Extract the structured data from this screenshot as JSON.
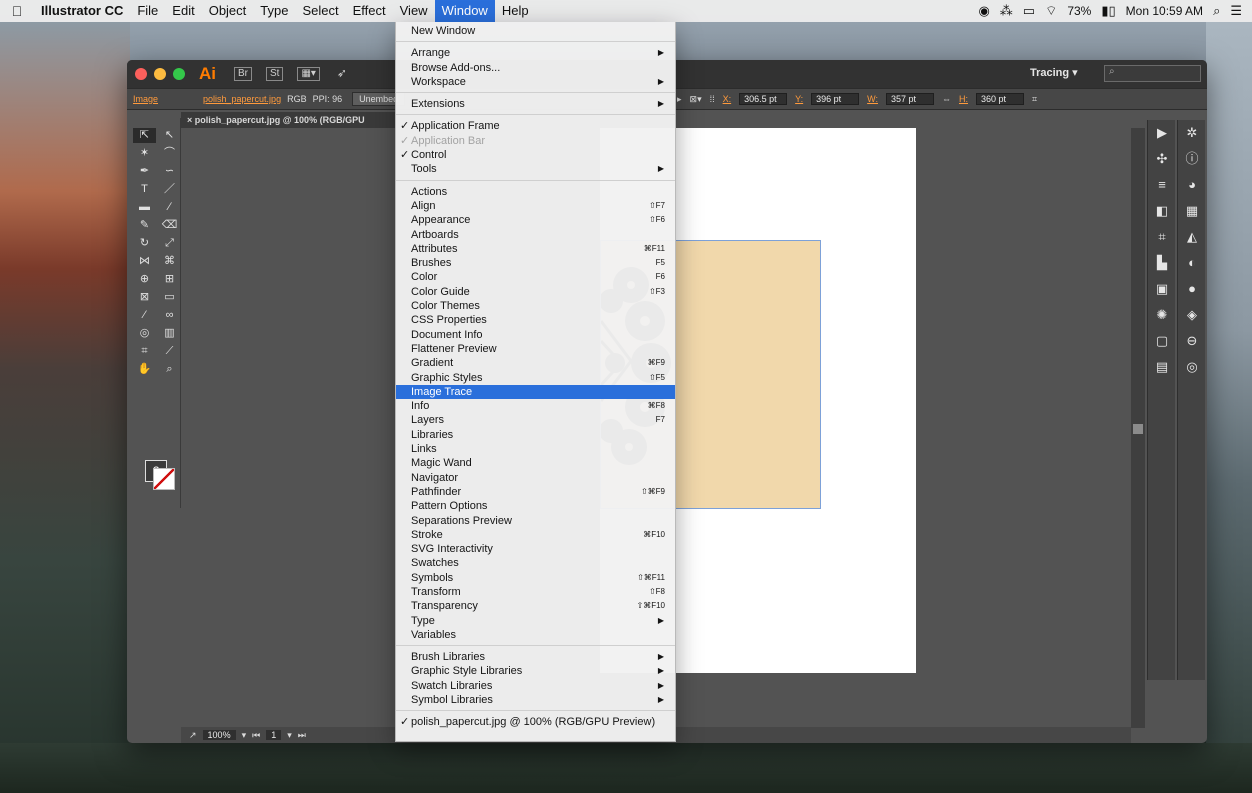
{
  "menubar": {
    "apple": "",
    "app": "Illustrator CC",
    "items": [
      "File",
      "Edit",
      "Object",
      "Type",
      "Select",
      "Effect",
      "View",
      "Window",
      "Help"
    ],
    "battery": "73%",
    "clock": "Mon 10:59 AM"
  },
  "window": {
    "workspace": "Tracing",
    "search_placeholder": "",
    "toolbar_icons": [
      "Br",
      "St",
      "grid",
      "send"
    ]
  },
  "control": {
    "image_label": "Image",
    "file": "polish_papercut.jpg",
    "color_mode": "RGB",
    "ppi": "PPI: 96",
    "unembed": "Unembed",
    "x_label": "X:",
    "x_value": "306.5 pt",
    "y_label": "Y:",
    "y_value": "396 pt",
    "w_label": "W:",
    "w_value": "357 pt",
    "h_label": "H:",
    "h_value": "360 pt"
  },
  "document": {
    "tab_title": "polish_papercut.jpg @ 100% (RGB/GPU Preview)",
    "zoom": "100%",
    "page": "1"
  },
  "window_menu": {
    "new_window": "New Window",
    "group1": [
      {
        "label": "Arrange",
        "arrow": true
      },
      {
        "label": "Browse Add-ons...",
        "arrow": false
      },
      {
        "label": "Workspace",
        "arrow": true
      }
    ],
    "extensions": "Extensions",
    "group2": [
      {
        "label": "Application Frame",
        "checked": true,
        "disabled": false
      },
      {
        "label": "Application Bar",
        "checked": true,
        "disabled": true
      },
      {
        "label": "Control",
        "checked": true,
        "disabled": false
      },
      {
        "label": "Tools",
        "checked": false,
        "disabled": false,
        "arrow": true
      }
    ],
    "panels": [
      {
        "label": "Actions",
        "shortcut": ""
      },
      {
        "label": "Align",
        "shortcut": "⇧F7"
      },
      {
        "label": "Appearance",
        "shortcut": "⇧F6"
      },
      {
        "label": "Artboards",
        "shortcut": ""
      },
      {
        "label": "Attributes",
        "shortcut": "⌘F11"
      },
      {
        "label": "Brushes",
        "shortcut": "F5"
      },
      {
        "label": "Color",
        "shortcut": "F6"
      },
      {
        "label": "Color Guide",
        "shortcut": "⇧F3"
      },
      {
        "label": "Color Themes",
        "shortcut": ""
      },
      {
        "label": "CSS Properties",
        "shortcut": ""
      },
      {
        "label": "Document Info",
        "shortcut": ""
      },
      {
        "label": "Flattener Preview",
        "shortcut": ""
      },
      {
        "label": "Gradient",
        "shortcut": "⌘F9"
      },
      {
        "label": "Graphic Styles",
        "shortcut": "⇧F5"
      },
      {
        "label": "Image Trace",
        "shortcut": "",
        "highlight": true
      },
      {
        "label": "Info",
        "shortcut": "⌘F8"
      },
      {
        "label": "Layers",
        "shortcut": "F7"
      },
      {
        "label": "Libraries",
        "shortcut": ""
      },
      {
        "label": "Links",
        "shortcut": ""
      },
      {
        "label": "Magic Wand",
        "shortcut": ""
      },
      {
        "label": "Navigator",
        "shortcut": ""
      },
      {
        "label": "Pathfinder",
        "shortcut": "⇧⌘F9"
      },
      {
        "label": "Pattern Options",
        "shortcut": ""
      },
      {
        "label": "Separations Preview",
        "shortcut": ""
      },
      {
        "label": "Stroke",
        "shortcut": "⌘F10"
      },
      {
        "label": "SVG Interactivity",
        "shortcut": ""
      },
      {
        "label": "Swatches",
        "shortcut": ""
      },
      {
        "label": "Symbols",
        "shortcut": "⇧⌘F11"
      },
      {
        "label": "Transform",
        "shortcut": "⇧F8"
      },
      {
        "label": "Transparency",
        "shortcut": "⇧⌘F10"
      },
      {
        "label": "Type",
        "shortcut": "",
        "arrow": true
      },
      {
        "label": "Variables",
        "shortcut": ""
      }
    ],
    "libraries": [
      {
        "label": "Brush Libraries"
      },
      {
        "label": "Graphic Style Libraries"
      },
      {
        "label": "Swatch Libraries"
      },
      {
        "label": "Symbol Libraries"
      }
    ],
    "open_doc": "polish_papercut.jpg @ 100% (RGB/GPU Preview)"
  },
  "colors": {
    "accent": "#2a6fdb",
    "ai_orange": "#ff7c00",
    "panel_bg": "#535353"
  }
}
